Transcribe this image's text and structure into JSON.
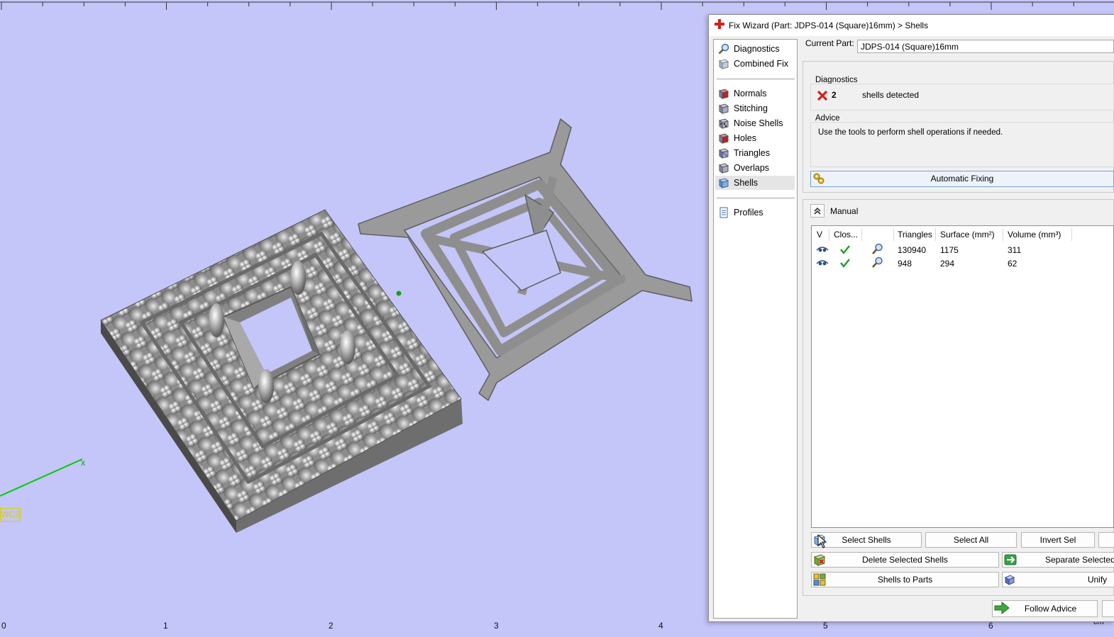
{
  "viewport": {
    "ruler_labels": [
      "0",
      "1",
      "2",
      "3",
      "4",
      "5",
      "6"
    ],
    "ruler_unit": "cm",
    "wcs_label": "WCS",
    "axis_marker": "x"
  },
  "wizard": {
    "title": "Fix Wizard (Part: JDPS-014  (Square)16mm) > Shells",
    "nav": {
      "top": [
        "Diagnostics",
        "Combined Fix"
      ],
      "fixes": [
        "Normals",
        "Stitching",
        "Noise Shells",
        "Holes",
        "Triangles",
        "Overlaps",
        "Shells"
      ],
      "bottom": [
        "Profiles"
      ],
      "selected": "Shells"
    },
    "current_part_label": "Current Part:",
    "current_part_value": "JDPS-014  (Square)16mm",
    "diagnostics": {
      "group_label": "Diagnostics",
      "count": "2",
      "message": "shells detected",
      "status_icon": "red-x-icon"
    },
    "advice": {
      "group_label": "Advice",
      "text": "Use the tools to perform shell operations if needed."
    },
    "automatic_fixing_label": "Automatic Fixing",
    "manual_label": "Manual",
    "table": {
      "columns": [
        "V",
        "Clos...",
        "",
        "Triangles",
        "Surface (mm²)",
        "Volume (mm³)"
      ],
      "rows": [
        {
          "triangles": "130940",
          "surface": "1175",
          "volume": "311",
          "closed": true
        },
        {
          "triangles": "948",
          "surface": "294",
          "volume": "62",
          "closed": true
        }
      ]
    },
    "buttons": {
      "select_shells": "Select Shells",
      "select_all": "Select All",
      "invert_sel": "Invert Sel",
      "delete_selected": "Delete Selected Shells",
      "separate_selected": "Separate Selected",
      "shells_to_parts": "Shells to Parts",
      "unify": "Unify",
      "follow_advice": "Follow Advice"
    },
    "colors": {
      "viewport_bg": "#c4c5f8",
      "panel_bg": "#f0f0f0",
      "accent_red": "#d32020",
      "check_green": "#1a9e2a"
    }
  }
}
